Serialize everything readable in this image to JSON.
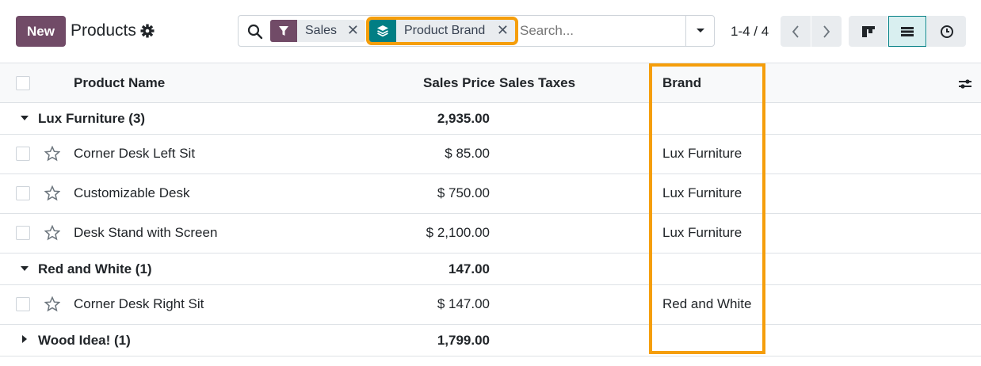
{
  "control_panel": {
    "new_label": "New",
    "title": "Products",
    "search": {
      "facets": [
        {
          "label": "Sales",
          "icon": "filter-icon",
          "color": "#714b67"
        },
        {
          "label": "Product Brand",
          "icon": "layers-icon",
          "color": "#017e84"
        }
      ],
      "placeholder": "Search..."
    },
    "pager": "1-4 / 4"
  },
  "table": {
    "headers": {
      "name": "Product Name",
      "price": "Sales Price",
      "taxes": "Sales Taxes",
      "brand": "Brand"
    },
    "groups": [
      {
        "label": "Lux Furniture (3)",
        "total": "2,935.00",
        "expanded": true,
        "rows": [
          {
            "name": "Corner Desk Left Sit",
            "price": "$ 85.00",
            "brand": "Lux Furniture"
          },
          {
            "name": "Customizable Desk",
            "price": "$ 750.00",
            "brand": "Lux Furniture"
          },
          {
            "name": "Desk Stand with Screen",
            "price": "$ 2,100.00",
            "brand": "Lux Furniture"
          }
        ]
      },
      {
        "label": "Red and White (1)",
        "total": "147.00",
        "expanded": true,
        "rows": [
          {
            "name": "Corner Desk Right Sit",
            "price": "$ 147.00",
            "brand": "Red and White"
          }
        ]
      },
      {
        "label": "Wood Idea! (1)",
        "total": "1,799.00",
        "expanded": false,
        "rows": []
      }
    ]
  },
  "colors": {
    "brand": "#714b67",
    "accent": "#017e84",
    "highlight": "#f59e0b"
  }
}
